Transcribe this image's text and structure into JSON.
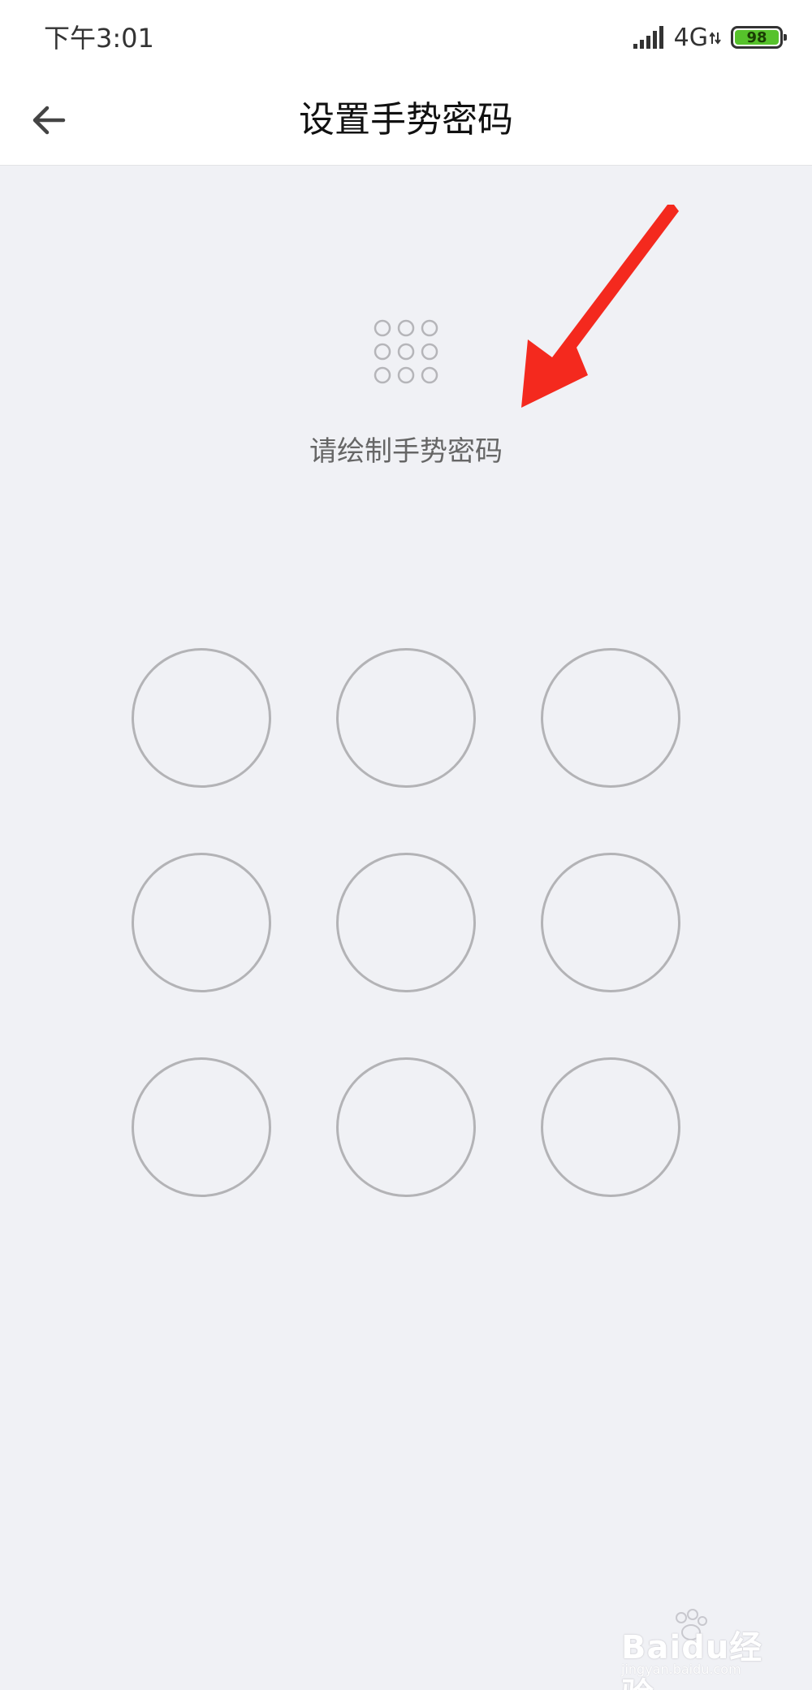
{
  "status_bar": {
    "time": "下午3:01",
    "network": "4G",
    "battery_level": "98",
    "battery_color": "#56c22b"
  },
  "app_bar": {
    "back_icon": "arrow-left-icon",
    "title": "设置手势密码"
  },
  "gesture": {
    "preview_icon": "nine-dot-grid-icon",
    "hint": "请绘制手势密码",
    "nodes": [
      1,
      2,
      3,
      4,
      5,
      6,
      7,
      8,
      9
    ],
    "node_border_color": "#b3b3b6"
  },
  "annotation": {
    "arrow_icon": "red-arrow-icon",
    "color": "#f4291e"
  },
  "watermark": {
    "brand": "Baidu经验",
    "sub": "jingyan.baidu.com"
  }
}
